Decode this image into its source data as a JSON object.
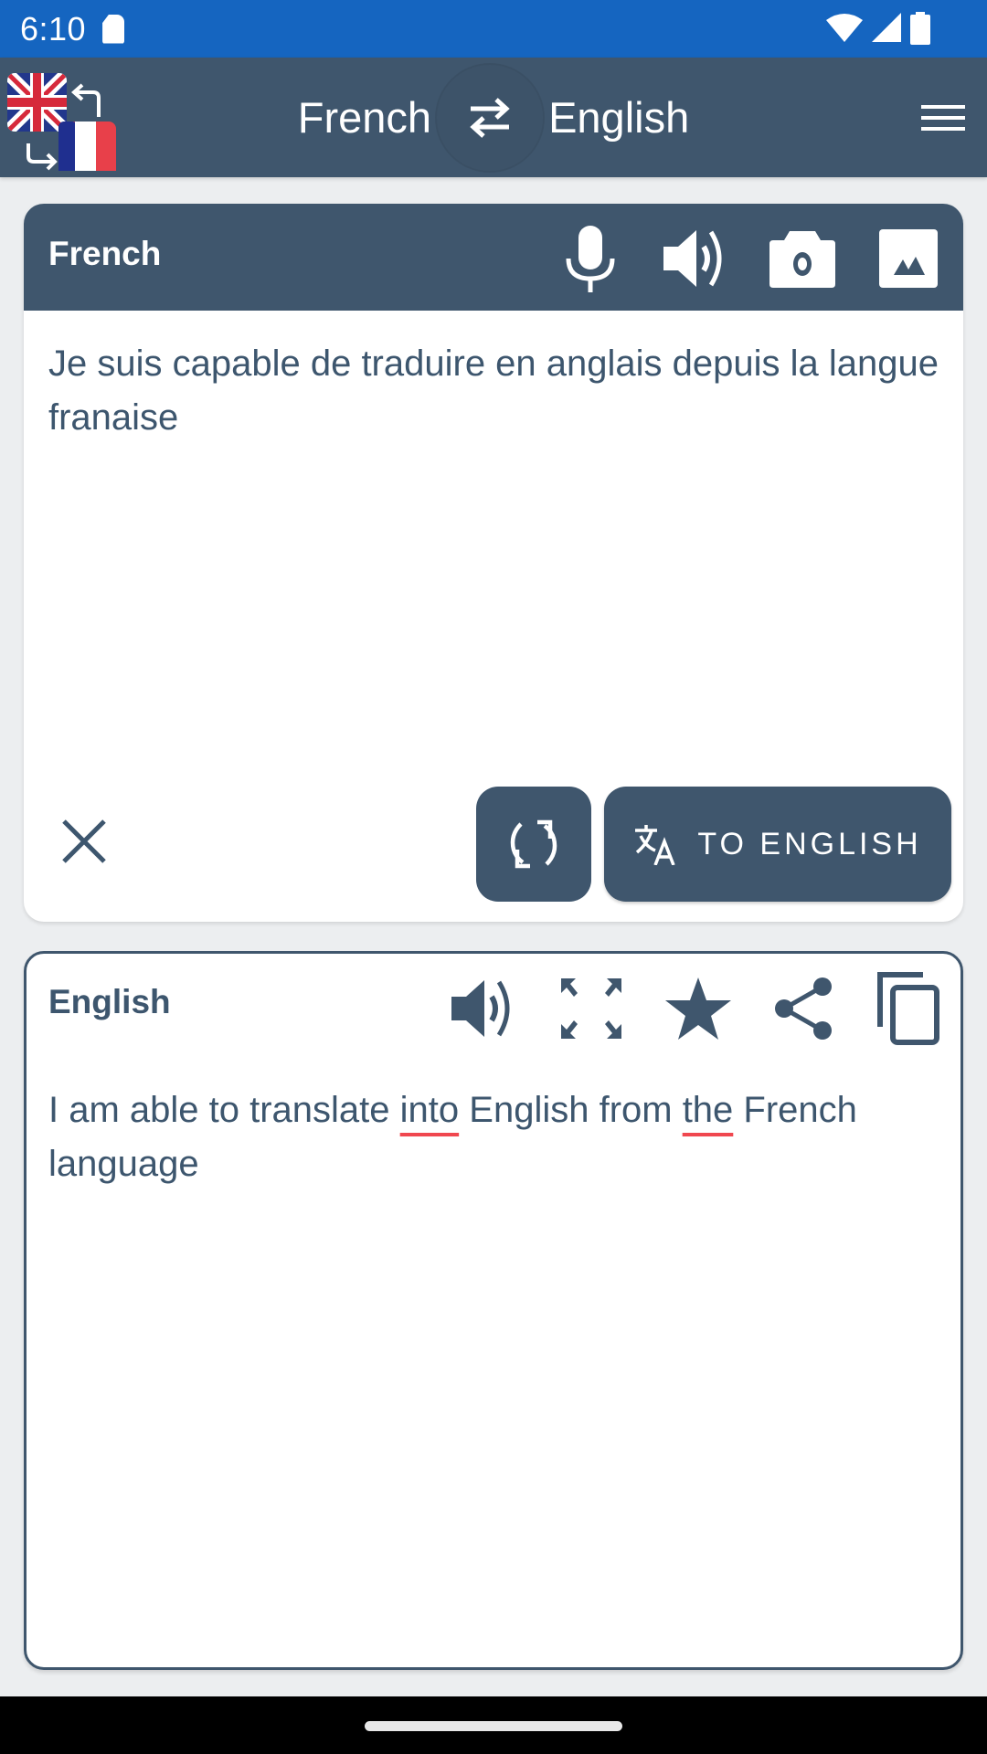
{
  "status_bar": {
    "time": "6:10",
    "icons": [
      "sd-card-icon",
      "wifi-icon",
      "signal-icon",
      "battery-icon"
    ]
  },
  "app_bar": {
    "logo": "uk-france-flags-swap-logo",
    "source_language": "French",
    "target_language": "English",
    "swap_icon": "swap-arrows-icon",
    "menu_icon": "hamburger-menu-icon"
  },
  "input_card": {
    "title": "French",
    "icons": [
      "microphone-icon",
      "speaker-icon",
      "camera-icon",
      "image-icon"
    ],
    "text": "Je suis capable de traduire en anglais depuis la langue franaise",
    "clear_icon": "close-icon",
    "refresh_icon": "refresh-icon",
    "translate_button": {
      "icon": "translate-icon",
      "label": "TO ENGLISH"
    }
  },
  "output_card": {
    "title": "English",
    "icons": [
      "speaker-icon",
      "fullscreen-icon",
      "star-icon",
      "share-icon",
      "copy-icon"
    ],
    "text_parts": [
      {
        "text": "I am able to translate ",
        "spell_error": false
      },
      {
        "text": "into",
        "spell_error": true
      },
      {
        "text": " English from ",
        "spell_error": false
      },
      {
        "text": "the",
        "spell_error": true
      },
      {
        "text": " French language",
        "spell_error": false
      }
    ]
  },
  "colors": {
    "status_bar": "#1565c0",
    "primary": "#3f566d",
    "text": "#3d566e",
    "background": "#eceef0",
    "spell_underline": "#f0474f"
  }
}
